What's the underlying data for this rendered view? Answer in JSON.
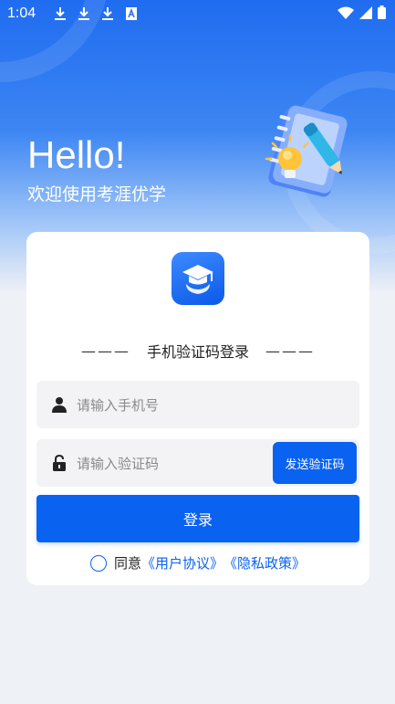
{
  "status_bar": {
    "time": "1:04",
    "icons": [
      "download-icon",
      "download-icon",
      "download-icon",
      "a-badge-icon",
      "wifi-icon",
      "signal-icon",
      "battery-icon"
    ]
  },
  "hero": {
    "greeting": "Hello!",
    "welcome": "欢迎使用考涯优学"
  },
  "login": {
    "dash_left": "———",
    "title": "手机验证码登录",
    "dash_right": "———",
    "phone_placeholder": "请输入手机号",
    "code_placeholder": "请输入验证码",
    "send_code": "发送验证码",
    "submit": "登录"
  },
  "agreement": {
    "prefix": "同意",
    "user_agreement": "《用户协议》",
    "privacy_policy": "《隐私政策》"
  },
  "colors": {
    "primary": "#0a62f0",
    "background": "#eef1f6"
  }
}
